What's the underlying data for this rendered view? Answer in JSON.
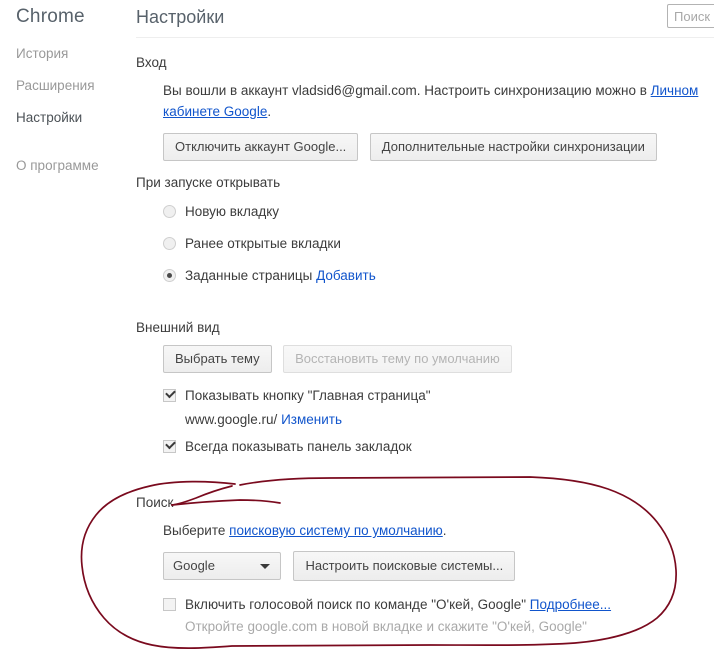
{
  "sidebar": {
    "brand": "Chrome",
    "items": [
      {
        "label": "История",
        "active": false
      },
      {
        "label": "Расширения",
        "active": false
      },
      {
        "label": "Настройки",
        "active": true
      },
      {
        "label": "О программе",
        "active": false
      }
    ]
  },
  "header": {
    "title": "Настройки",
    "search_placeholder": "Поиск",
    "search_value": ""
  },
  "signin": {
    "section_title": "Вход",
    "text_before_link": "Вы вошли в аккаунт vladsid6@gmail.com. Настроить синхронизацию можно в ",
    "link_text": "Личном кабинете Google",
    "text_after_link": ".",
    "account_email": "vladsid6@gmail.com",
    "disconnect_button": "Отключить аккаунт Google...",
    "advanced_sync_button": "Дополнительные настройки синхронизации"
  },
  "startup": {
    "section_title": "При запуске открывать",
    "options": [
      {
        "label": "Новую вкладку",
        "selected": false
      },
      {
        "label": "Ранее открытые вкладки",
        "selected": false
      },
      {
        "label": "Заданные страницы",
        "selected": true,
        "link": "Добавить"
      }
    ]
  },
  "appearance": {
    "section_title": "Внешний вид",
    "choose_theme_button": "Выбрать тему",
    "reset_theme_button": "Восстановить тему по умолчанию",
    "reset_theme_disabled": true,
    "show_home_button": {
      "label": "Показывать кнопку \"Главная страница\"",
      "checked": true
    },
    "home_url": "www.google.ru/",
    "home_change_link": "Изменить",
    "always_show_bookmarks": {
      "label": "Всегда показывать панель закладок",
      "checked": true
    }
  },
  "search": {
    "section_title": "Поиск",
    "choose_prefix": "Выберите ",
    "choose_link": "поисковую систему по умолчанию",
    "choose_suffix": ".",
    "engine_selected": "Google",
    "engine_options": [
      "Google"
    ],
    "manage_engines_button": "Настроить поисковые системы...",
    "voice_search": {
      "label": "Включить голосовой поиск по команде \"О'кей, Google\"",
      "checked": false,
      "learn_more_link": "Подробнее..."
    },
    "voice_hint": "Откройте google.com в новой вкладке и скажите \"О'кей, Google\""
  },
  "annotation": {
    "shape": "hand-drawn-oval",
    "color": "#7a0a1e",
    "stroke_width": 1.6,
    "encircles": "search-section"
  }
}
